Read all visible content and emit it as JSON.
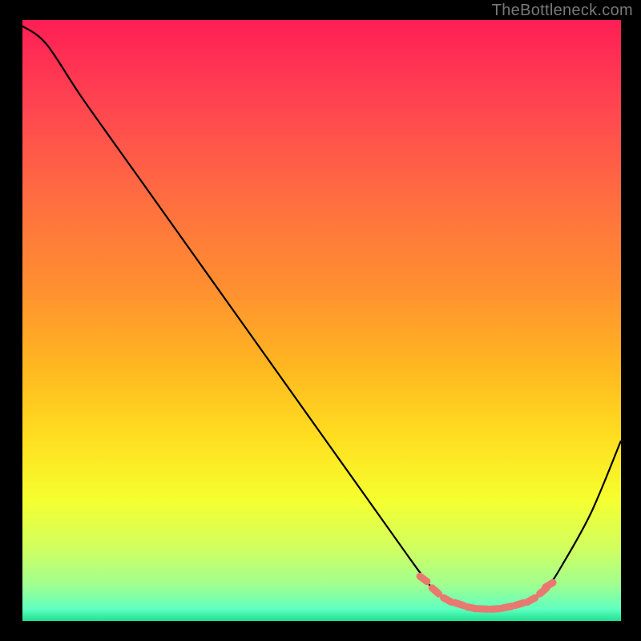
{
  "watermark": "TheBottleneck.com",
  "colors": {
    "background": "#000000",
    "watermark_text": "#787878",
    "curve": "#000000",
    "marker_fill": "#e87870",
    "gradient_stops": [
      {
        "offset": 0,
        "color": "#ff1e55"
      },
      {
        "offset": 0.15,
        "color": "#ff4750"
      },
      {
        "offset": 0.3,
        "color": "#ff6e40"
      },
      {
        "offset": 0.45,
        "color": "#ff9030"
      },
      {
        "offset": 0.58,
        "color": "#ffb820"
      },
      {
        "offset": 0.7,
        "color": "#ffe020"
      },
      {
        "offset": 0.8,
        "color": "#f5ff30"
      },
      {
        "offset": 0.88,
        "color": "#d0ff60"
      },
      {
        "offset": 0.94,
        "color": "#a0ff90"
      },
      {
        "offset": 0.98,
        "color": "#60ffc0"
      },
      {
        "offset": 1.0,
        "color": "#20e090"
      }
    ]
  },
  "chart_data": {
    "type": "line",
    "title": "",
    "xlabel": "",
    "ylabel": "",
    "xlim": [
      0,
      100
    ],
    "ylim": [
      0,
      100
    ],
    "series": [
      {
        "name": "bottleneck-curve",
        "x": [
          0,
          4,
          10,
          20,
          30,
          40,
          50,
          60,
          65,
          68,
          70,
          72,
          74,
          76,
          78,
          80,
          82,
          84,
          86,
          88,
          90,
          95,
          100
        ],
        "y": [
          99,
          96,
          87,
          73,
          59,
          45,
          31,
          17,
          10,
          6,
          4,
          3,
          2.5,
          2,
          2,
          2,
          2.5,
          3,
          4,
          6,
          9,
          18,
          30
        ]
      }
    ],
    "markers": {
      "name": "highlight-markers",
      "x": [
        67,
        69,
        71,
        73,
        75,
        77,
        79,
        81,
        83,
        85,
        87,
        88
      ],
      "y": [
        7,
        5,
        3.5,
        2.8,
        2.2,
        2,
        2,
        2.3,
        2.8,
        3.5,
        5,
        6
      ]
    }
  }
}
